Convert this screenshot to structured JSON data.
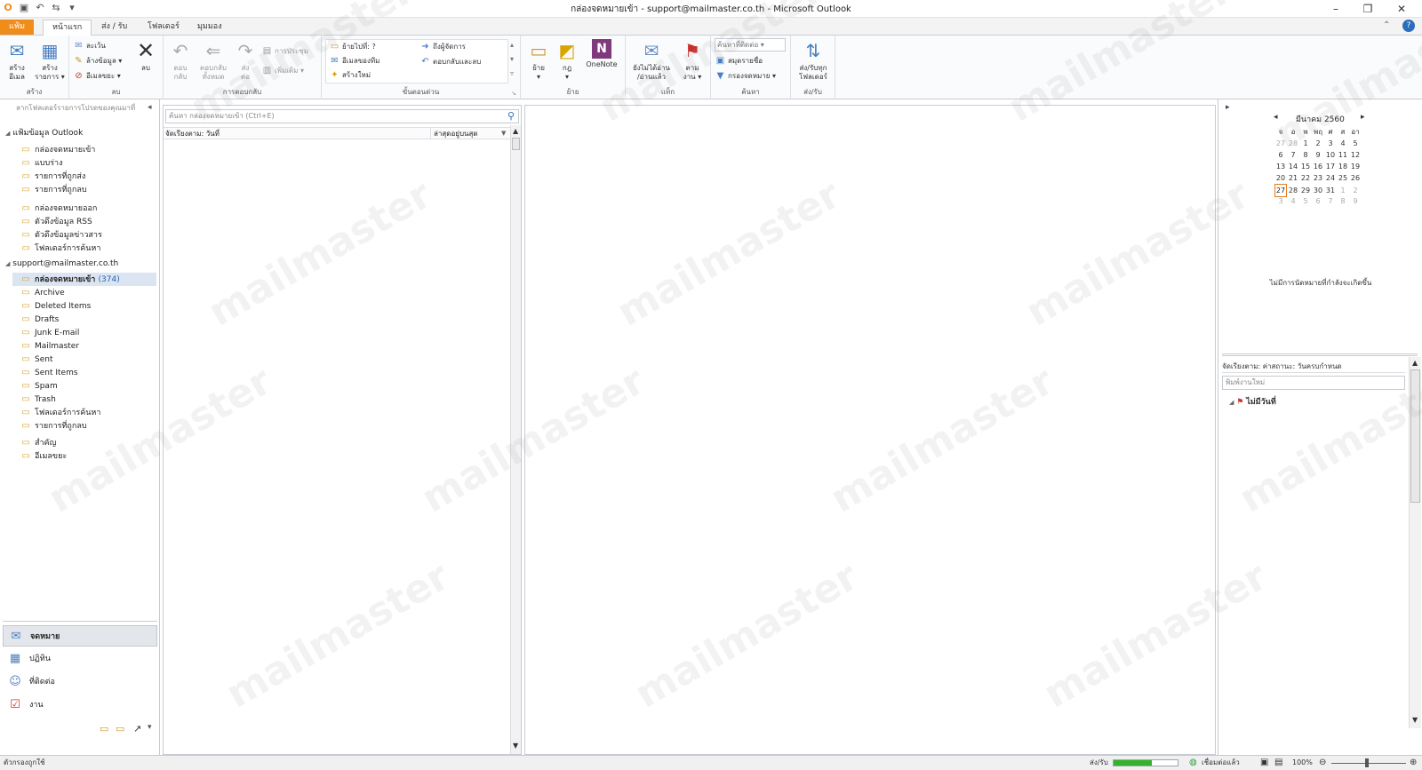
{
  "window": {
    "title": "กล่องจดหมายเข้า - support@mailmaster.co.th  -  Microsoft Outlook",
    "minimize": "–",
    "restore": "❐",
    "close": "✕"
  },
  "tabs": [
    "แฟ้ม",
    "หน้าแรก",
    "ส่ง / รับ",
    "โฟลเดอร์",
    "มุมมอง"
  ],
  "ribbon": {
    "new_email": "สร้าง\nอีเมล",
    "new_items": "สร้าง\nรายการ ▾",
    "group_new": "สร้าง",
    "ignore": "ละเว้น",
    "cleanup": "ล้างข้อมูล ▾",
    "junk": "อีเมลขยะ ▾",
    "delete": "ลบ",
    "group_delete": "ลบ",
    "reply": "ตอบ\nกลับ",
    "reply_all": "ตอบกลับ\nทั้งหมด",
    "forward": "ส่ง\nต่อ",
    "meeting": "การประชุม",
    "more": "เพิ่มเติม ▾",
    "group_respond": "การตอบกลับ",
    "qs_move_to": "ย้ายไปที่: ?",
    "qs_team_email": "อีเมลของทีม",
    "qs_create_new": "สร้างใหม่",
    "qs_to_manager": "ถึงผู้จัดการ",
    "qs_reply_delete": "ตอบกลับและลบ",
    "group_quicksteps": "ขั้นตอนด่วน",
    "move": "ย้าย\n▾",
    "rules": "กฎ\n▾",
    "onenote": "OneNote",
    "group_move": "ย้าย",
    "unread_read": "ยังไม่ได้อ่าน\n/อ่านแล้ว",
    "followup": "ตาม\nงาน ▾",
    "group_tags": "แท็ก",
    "find_contact": "ค้นหาที่ติดต่อ",
    "address_book": "สมุดรายชื่อ",
    "filter_email": "กรองจดหมาย ▾",
    "group_find": "ค้นหา",
    "sendrecv_all": "ส่ง/รับทุก\nโฟลเดอร์",
    "group_sendrecv": "ส่ง/รับ"
  },
  "folder_pane": {
    "header": "ลากโฟลเดอร์รายการโปรดของคุณมาที่",
    "section_outlook": "แฟ้มข้อมูล Outlook",
    "outlook_items": [
      "กล่องจดหมายเข้า",
      "แบบร่าง",
      "รายการที่ถูกส่ง",
      "รายการที่ถูกลบ",
      "กล่องจดหมายออก",
      "ตัวดึงข้อมูล RSS",
      "ตัวดึงข้อมูลข่าวสาร",
      "โฟลเดอร์การค้นหา"
    ],
    "section_account": "support@mailmaster.co.th",
    "inbox_label": "กล่องจดหมายเข้า",
    "inbox_count": "(374)",
    "account_items": [
      "Archive",
      "Deleted Items",
      "Drafts",
      "Junk E-mail",
      "Mailmaster",
      "Sent",
      "Sent Items",
      "Spam",
      "Trash",
      "โฟลเดอร์การค้นหา",
      "รายการที่ถูกลบ"
    ],
    "extra_items": [
      "สำคัญ",
      "อีเมลขยะ"
    ]
  },
  "nav": [
    "จดหมาย",
    "ปฏิทิน",
    "ที่ติดต่อ",
    "งาน"
  ],
  "message_list": {
    "search_placeholder": "ค้นหา กล่องจดหมายเข้า (Ctrl+E)",
    "sort_by": "จัดเรียงตาม: วันที่",
    "sort_order": "ล่าสุดอยู่บนสุด"
  },
  "todo": {
    "month": "มีนาคม 2560",
    "weekdays": [
      "จ",
      "อ",
      "พ",
      "พฤ",
      "ศ",
      "ส",
      "อา"
    ],
    "weeks": [
      [
        "27",
        "28",
        "1",
        "2",
        "3",
        "4",
        "5"
      ],
      [
        "6",
        "7",
        "8",
        "9",
        "10",
        "11",
        "12"
      ],
      [
        "13",
        "14",
        "15",
        "16",
        "17",
        "18",
        "19"
      ],
      [
        "20",
        "21",
        "22",
        "23",
        "24",
        "25",
        "26"
      ],
      [
        "27",
        "28",
        "29",
        "30",
        "31",
        "1",
        "2"
      ],
      [
        "3",
        "4",
        "5",
        "6",
        "7",
        "8",
        "9"
      ]
    ],
    "no_appointments": "ไม่มีการนัดหมายที่กำลังจะเกิดขึ้น",
    "sort_label": "จัดเรียงตาม: ค่าสถานะ: วันครบกำหนด",
    "new_task_placeholder": "พิมพ์งานใหม่",
    "no_date": "ไม่มีวันที่"
  },
  "statusbar": {
    "filter": "ตัวกรองถูกใช้",
    "sendrecv": "ส่ง/รับ",
    "connected": "เชื่อมต่อแล้ว",
    "zoom": "100%",
    "progress_fraction": 0.6
  },
  "watermark": "mailmaster"
}
